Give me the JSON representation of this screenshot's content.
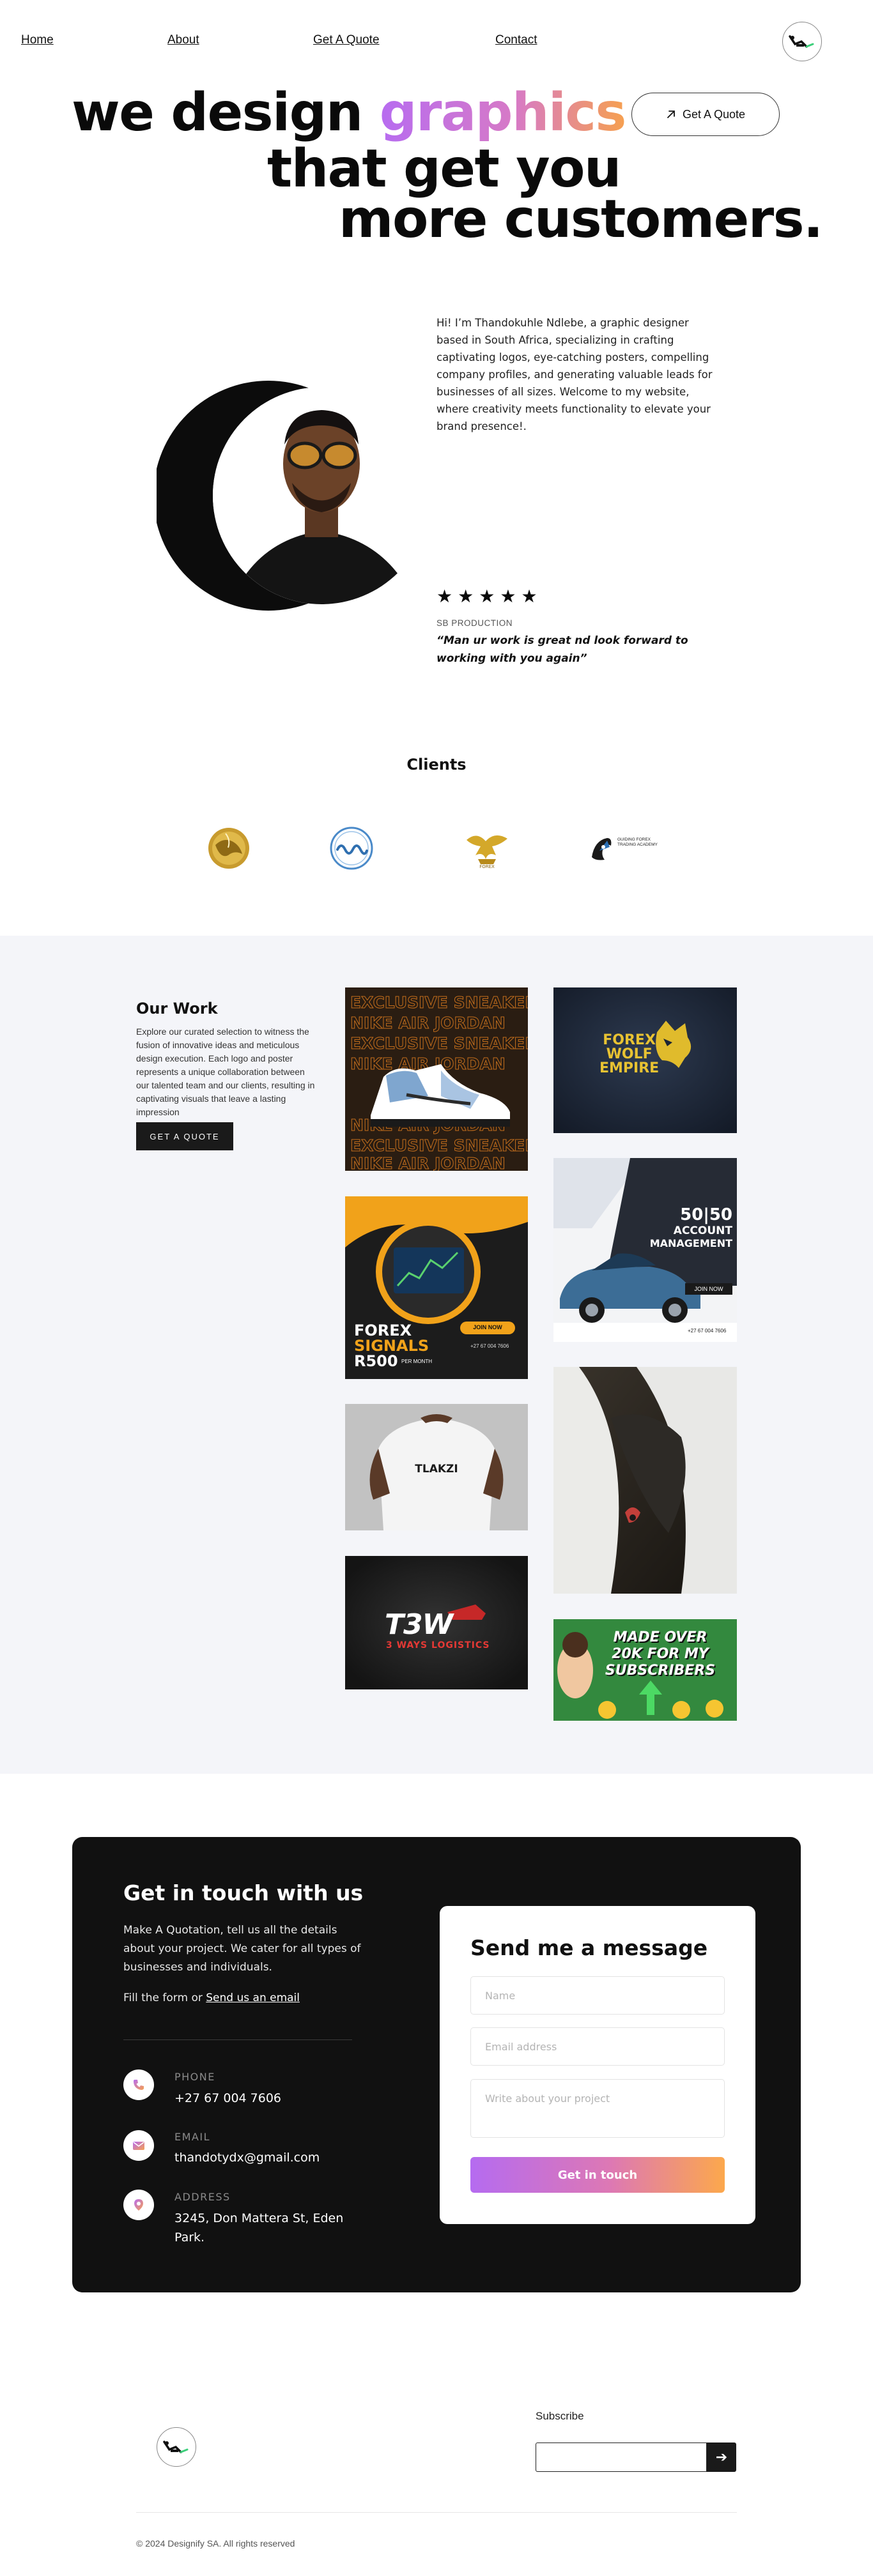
{
  "nav": {
    "home": "Home",
    "about": "About",
    "quote": "Get A Quote",
    "contact": "Contact"
  },
  "hero": {
    "line1_plain": "we design",
    "line1_accent": "graphics",
    "line2": "that get you",
    "line3": "more customers.",
    "cta_label": "Get A Quote"
  },
  "about": {
    "bio": "Hi! I’m Thandokuhle Ndlebe, a graphic designer based in South Africa, specializing in crafting captivating logos, eye-catching posters, compelling company profiles, and generating valuable leads for businesses of all sizes. Welcome to my website, where creativity meets functionality to elevate your brand presence!.",
    "rating": 5,
    "testimonial_source": "SB PRODUCTION",
    "testimonial_quote": "“Man ur work is great nd look forward to working with you again”"
  },
  "clients": {
    "title": "Clients",
    "logos": [
      "gold-globe-logo",
      "blue-wave-logo",
      "gold-bird-logo",
      "forex-academy-logo"
    ],
    "forex_academy_label": "GUIDING FOREX\nTRADING ACADEMY"
  },
  "work": {
    "title": "Our Work",
    "description": " Explore our curated selection to witness the fusion of innovative ideas and meticulous design execution. Each logo and poster represents a unique collaboration between our talented team and our clients, resulting in captivating visuals that leave a lasting impression",
    "button_label": "GET A QUOTE",
    "sneaker": {
      "line_a": "EXCLUSIVE SNEAKERS",
      "line_b": "NIKE AIR JORDAN"
    },
    "forex_wolf": "FOREX\nWOLF\nEMPIRE",
    "account_mgmt": {
      "heading": "50|50",
      "sub1": "ACCOUNT",
      "sub2": "MANAGEMENT",
      "join": "JOIN NOW",
      "phone": "+27 67 004 7606"
    },
    "forex_signals": {
      "brand": "FOREX",
      "title": "SIGNALS",
      "price": "R500",
      "price_note": "PER MONTH",
      "cta": "JOIN NOW",
      "phone": "+27 67 004 7606"
    },
    "tshirt_text": "TLAKZI",
    "t3w": {
      "big": "T3W",
      "small": "3 WAYS LOGISTICS"
    },
    "subscribers_text": "MADE OVER\n20K FOR MY\nSUBSCRIBERS"
  },
  "contact": {
    "title": "Get in touch with us",
    "description": "Make A Quotation, tell us all the details about your project. We cater for all types of businesses and individuals.",
    "fill_prefix": "Fill the form or",
    "email_link": "Send us an email",
    "phone_label": "PHONE",
    "phone_value": "+27 67 004 7606",
    "email_label": "EMAIL",
    "email_value": "thandotydx@gmail.com",
    "address_label": "ADDRESS",
    "address_value": "3245, Don Mattera St, Eden Park."
  },
  "form": {
    "title": "Send me a message",
    "name_placeholder": "Name",
    "email_placeholder": "Email address",
    "project_placeholder": "Write about your project",
    "submit_label": "Get in touch"
  },
  "footer": {
    "subscribe_label": "Subscribe",
    "subscribe_button": "➔",
    "copyright": "© 2024 Designify SA. All rights reserved"
  },
  "colors": {
    "accent_purple": "#b76cf0",
    "accent_orange": "#f6a050",
    "dark": "#111111",
    "work_bg": "#f4f5f9"
  }
}
